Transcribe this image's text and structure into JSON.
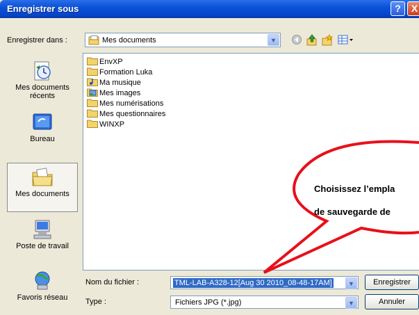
{
  "window": {
    "title": "Enregistrer sous"
  },
  "titlebar": {
    "help": "?",
    "close": "X"
  },
  "save_in": {
    "label": "Enregistrer dans :",
    "value": "Mes documents"
  },
  "places": [
    {
      "label": "Mes documents récents"
    },
    {
      "label": "Bureau"
    },
    {
      "label": "Mes documents"
    },
    {
      "label": "Poste de travail"
    },
    {
      "label": "Favoris réseau"
    }
  ],
  "files": [
    {
      "name": "EnvXP"
    },
    {
      "name": "Formation Luka"
    },
    {
      "name": "Ma musique"
    },
    {
      "name": "Mes images"
    },
    {
      "name": "Mes numérisations"
    },
    {
      "name": "Mes questionnaires"
    },
    {
      "name": "WINXP"
    }
  ],
  "filename": {
    "label": "Nom du fichier :",
    "value": "TML-LAB-A328-12[Aug 30 2010_08-48-17AM]"
  },
  "filetype": {
    "label": "Type :",
    "value": "Fichiers JPG (*.jpg)"
  },
  "buttons": {
    "save": "Enregistrer",
    "cancel": "Annuler"
  },
  "callout": {
    "line1": "Choisissez l’empla",
    "line2": "de sauvegarde de"
  },
  "colors": {
    "titlebar": "#0a52d8",
    "selection": "#316ac5",
    "callout_border": "#e8101a"
  },
  "icons": {
    "folder": "folder-icon",
    "back": "back-icon",
    "up": "up-folder-icon",
    "new_folder": "new-folder-icon",
    "view": "view-menu-icon"
  }
}
